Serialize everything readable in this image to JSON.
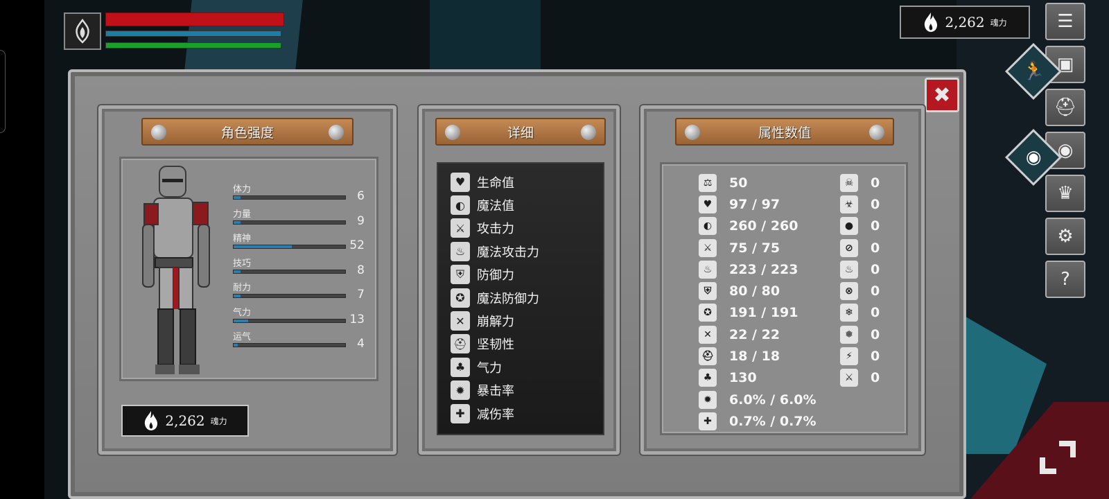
{
  "hud": {
    "emblem_icon": "flame-crest-icon",
    "bars": {
      "hp": 1.0,
      "mp": 1.0,
      "stamina": 1.0
    },
    "soul": {
      "icon": "flame-icon",
      "value": "2,262",
      "unit": "魂力"
    }
  },
  "side_menu": [
    {
      "icon": "list-menu-icon",
      "glyph": "☰"
    },
    {
      "icon": "inventory-icon",
      "glyph": "▣"
    },
    {
      "icon": "helmet-icon",
      "glyph": "⛑"
    },
    {
      "icon": "skill-orb-icon",
      "glyph": "◉"
    },
    {
      "icon": "crown-icon",
      "glyph": "♛"
    },
    {
      "icon": "gear-icon",
      "glyph": "⚙"
    },
    {
      "icon": "help-icon",
      "glyph": "?"
    }
  ],
  "close": {
    "icon": "close-icon",
    "glyph": "✖"
  },
  "character_panel": {
    "title": "角色强度",
    "stats": [
      {
        "label": "体力",
        "value": "6",
        "fill": 0.06
      },
      {
        "label": "力量",
        "value": "9",
        "fill": 0.06
      },
      {
        "label": "精神",
        "value": "52",
        "fill": 0.52
      },
      {
        "label": "技巧",
        "value": "8",
        "fill": 0.06
      },
      {
        "label": "耐力",
        "value": "7",
        "fill": 0.06
      },
      {
        "label": "气力",
        "value": "13",
        "fill": 0.13
      },
      {
        "label": "运气",
        "value": "4",
        "fill": 0.04
      }
    ],
    "soul": {
      "icon": "flame-icon",
      "value": "2,262",
      "unit": "魂力"
    }
  },
  "detail_panel": {
    "title": "详细",
    "rows": [
      {
        "icon": "heart-icon",
        "glyph": "♥",
        "label": "生命值"
      },
      {
        "icon": "mana-head-icon",
        "glyph": "◐",
        "label": "魔法值"
      },
      {
        "icon": "sword-icon",
        "glyph": "⚔",
        "label": "攻击力"
      },
      {
        "icon": "magic-attack-icon",
        "glyph": "♨",
        "label": "魔法攻击力"
      },
      {
        "icon": "shield-icon",
        "glyph": "⛨",
        "label": "防御力"
      },
      {
        "icon": "magic-shield-icon",
        "glyph": "✪",
        "label": "魔法防御力"
      },
      {
        "icon": "break-icon",
        "glyph": "✕",
        "label": "崩解力"
      },
      {
        "icon": "helmet-icon",
        "glyph": "⛑",
        "label": "坚韧性"
      },
      {
        "icon": "lungs-icon",
        "glyph": "♣",
        "label": "气力"
      },
      {
        "icon": "crit-star-icon",
        "glyph": "✹",
        "label": "暴击率"
      },
      {
        "icon": "damage-reduction-icon",
        "glyph": "✚",
        "label": "减伤率"
      }
    ]
  },
  "attribute_panel": {
    "title": "属性数值",
    "left": [
      {
        "icon": "weight-icon",
        "glyph": "⚖",
        "value": "50"
      },
      {
        "icon": "heart-icon",
        "glyph": "♥",
        "value": "97 / 97"
      },
      {
        "icon": "mana-head-icon",
        "glyph": "◐",
        "value": "260 / 260"
      },
      {
        "icon": "sword-icon",
        "glyph": "⚔",
        "value": "75 / 75"
      },
      {
        "icon": "magic-attack-icon",
        "glyph": "♨",
        "value": "223 / 223"
      },
      {
        "icon": "shield-icon",
        "glyph": "⛨",
        "value": "80 / 80"
      },
      {
        "icon": "magic-shield-icon",
        "glyph": "✪",
        "value": "191 / 191"
      },
      {
        "icon": "break-icon",
        "glyph": "✕",
        "value": "22 / 22"
      },
      {
        "icon": "helmet-icon",
        "glyph": "⛑",
        "value": "18 / 18"
      },
      {
        "icon": "lungs-icon",
        "glyph": "♣",
        "value": "130"
      },
      {
        "icon": "crit-star-icon",
        "glyph": "✹",
        "value": "6.0% / 6.0%"
      },
      {
        "icon": "damage-reduction-icon",
        "glyph": "✚",
        "value": "0.7% / 0.7%"
      }
    ],
    "right": [
      {
        "icon": "poison-skull-icon",
        "glyph": "☠",
        "value": "0"
      },
      {
        "icon": "poison-resist-icon",
        "glyph": "☣",
        "value": "0"
      },
      {
        "icon": "bleed-drop-icon",
        "glyph": "●",
        "value": "0"
      },
      {
        "icon": "bleed-resist-icon",
        "glyph": "⊘",
        "value": "0"
      },
      {
        "icon": "fire-icon",
        "glyph": "♨",
        "value": "0"
      },
      {
        "icon": "fire-resist-icon",
        "glyph": "⊗",
        "value": "0"
      },
      {
        "icon": "frost-icon",
        "glyph": "❄",
        "value": "0"
      },
      {
        "icon": "frost-resist-icon",
        "glyph": "❅",
        "value": "0"
      },
      {
        "icon": "lightning-icon",
        "glyph": "⚡",
        "value": "0"
      },
      {
        "icon": "lightning-resist-icon",
        "glyph": "⚔",
        "value": "0"
      }
    ]
  }
}
